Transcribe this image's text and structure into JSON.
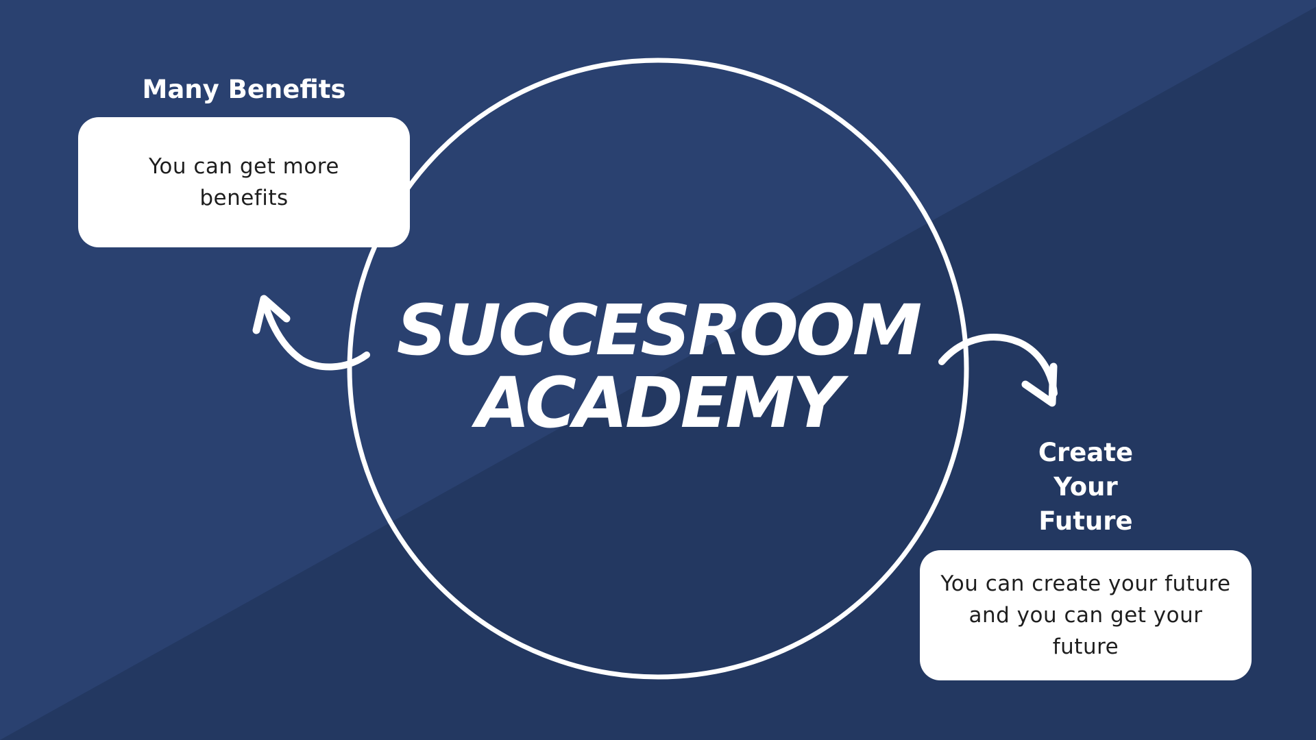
{
  "colors": {
    "background": "#2a4170",
    "background_shade": "#233861",
    "foreground": "#ffffff",
    "card_text": "#1e1e1e"
  },
  "title": {
    "line1": "SUCCESROOM",
    "line2": "ACADEMY"
  },
  "left_node": {
    "heading": "Many Benefits",
    "body": "You can get more benefits"
  },
  "right_node": {
    "heading": "Create Your Future",
    "body": "You can create your future and you can get your future"
  },
  "icons": {
    "left_arrow": "curved-arrow-up-left-icon",
    "right_arrow": "curved-arrow-down-right-icon"
  }
}
